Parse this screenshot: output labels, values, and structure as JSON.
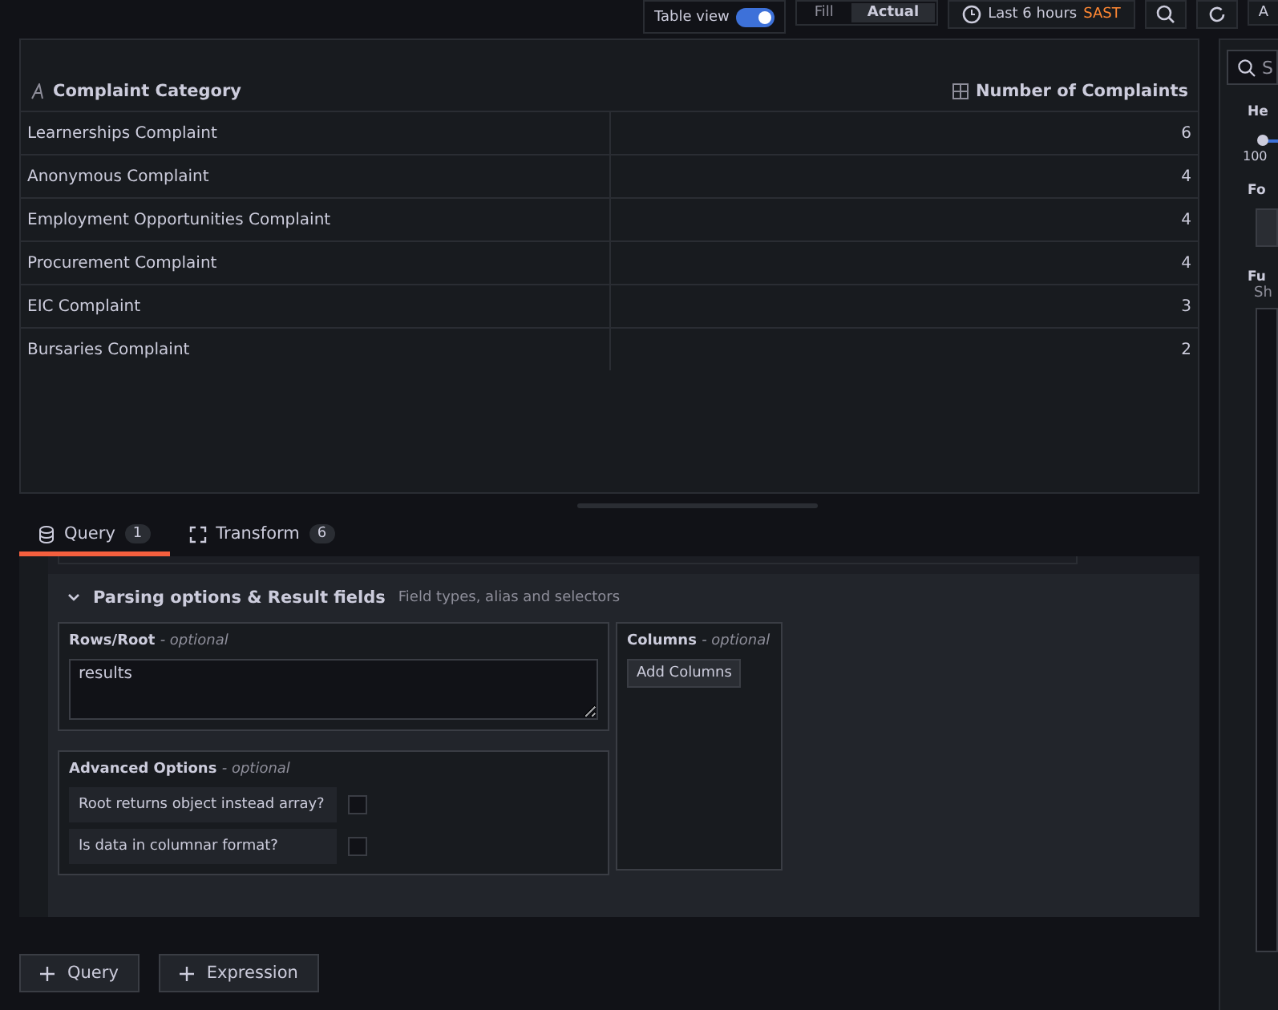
{
  "toolbar": {
    "table_view": {
      "label": "Table view",
      "on": true
    },
    "view_modes": [
      {
        "label": "Fill",
        "selected": false
      },
      {
        "label": "Actual",
        "selected": true
      }
    ],
    "time_range": {
      "label": "Last 6 hours",
      "zone": "SAST"
    },
    "apply_label": "A"
  },
  "table": {
    "columns": [
      {
        "name": "Complaint Category",
        "kind": "text"
      },
      {
        "name": "Number of Complaints",
        "kind": "number"
      }
    ],
    "rows": [
      [
        "Learnerships Complaint",
        "6"
      ],
      [
        "Anonymous Complaint",
        "4"
      ],
      [
        "Employment Opportunities Complaint",
        "4"
      ],
      [
        "Procurement Complaint",
        "4"
      ],
      [
        "EIC Complaint",
        "3"
      ],
      [
        "Bursaries Complaint",
        "2"
      ]
    ]
  },
  "tabs": [
    {
      "label": "Query",
      "count": "1",
      "kind": "query",
      "selected": true
    },
    {
      "label": "Transform",
      "count": "6",
      "kind": "transform",
      "selected": false
    }
  ],
  "parsing": {
    "title": "Parsing options & Result fields",
    "subtitle": "Field types, alias and selectors",
    "expanded": true,
    "rows_root": {
      "label": "Rows/Root",
      "optional": "- optional",
      "value": "results"
    },
    "advanced": {
      "label": "Advanced Options",
      "optional": "- optional",
      "options": [
        {
          "label": "Root returns object instead array?",
          "checked": false
        },
        {
          "label": "Is data in columnar format?",
          "checked": false
        }
      ]
    },
    "columns": {
      "label": "Columns",
      "optional": "- optional",
      "button": "Add Columns"
    }
  },
  "add_buttons": [
    "Query",
    "Expression"
  ],
  "options_pane": {
    "search_placeholder": "S",
    "height_label": "He",
    "height_value": "100",
    "height_slider": {
      "level": 0.05
    },
    "font_label": "Fo",
    "fu_label": "Fu",
    "sh_text": "Sh"
  }
}
